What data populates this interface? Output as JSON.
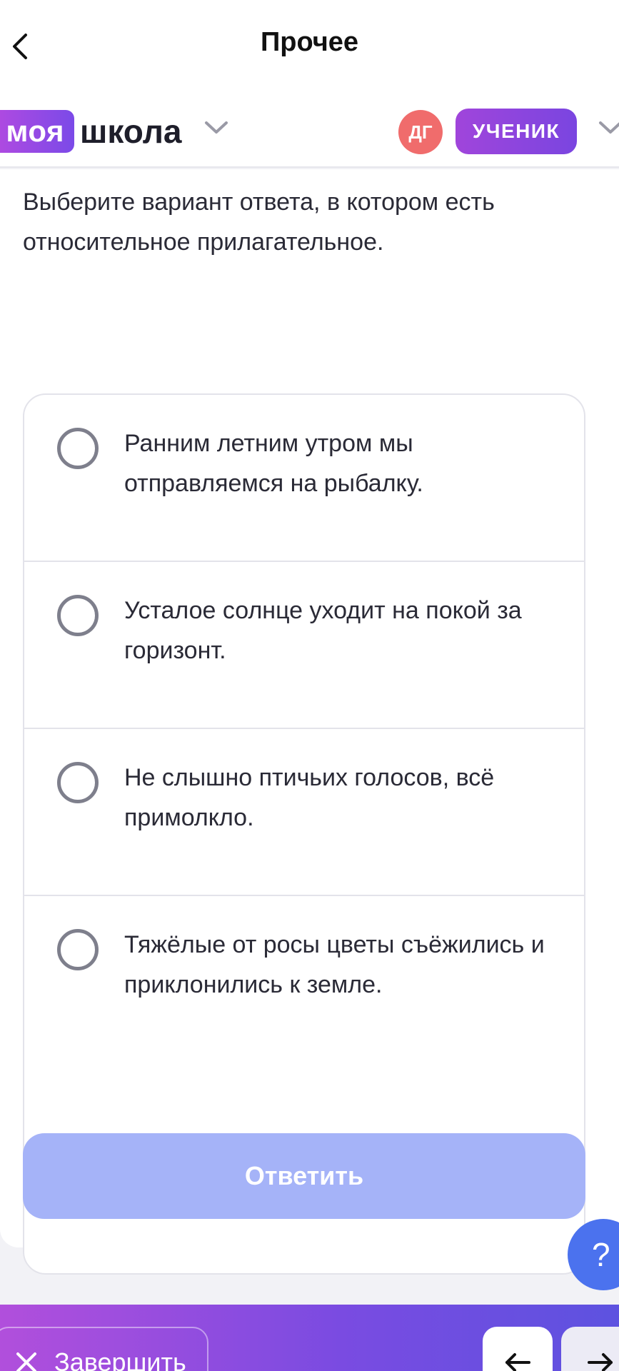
{
  "header": {
    "title": "Прочее"
  },
  "brand": {
    "logo_part": "моя",
    "logo_word": "школа"
  },
  "user": {
    "initials": "ДГ",
    "role": "УЧЕНИК"
  },
  "question": {
    "text": "Выберите вариант ответа, в котором есть относительное прилагательное."
  },
  "options": [
    {
      "label": "Ранним летним утром мы отправляемся на рыбалку."
    },
    {
      "label": "Усталое солнце уходит на покой за горизонт."
    },
    {
      "label": "Не слышно птичьих голосов, всё примолкло."
    },
    {
      "label": "Тяжёлые от росы цветы съёжились и приклонились к земле."
    }
  ],
  "actions": {
    "answer_label": "Ответить",
    "help_label": "?",
    "finish_label": "Завершить"
  },
  "colors": {
    "brand_gradient_start": "#b44ae0",
    "brand_gradient_end": "#7b4ae8",
    "avatar": "#f06c6c",
    "answer_button_disabled": "#a5b3f8",
    "help_button": "#4b72ee"
  },
  "icons": {
    "back": "chevron-left-icon",
    "dropdown": "chevron-down-icon",
    "close": "close-icon",
    "prev": "arrow-left-icon",
    "next": "arrow-right-icon"
  }
}
